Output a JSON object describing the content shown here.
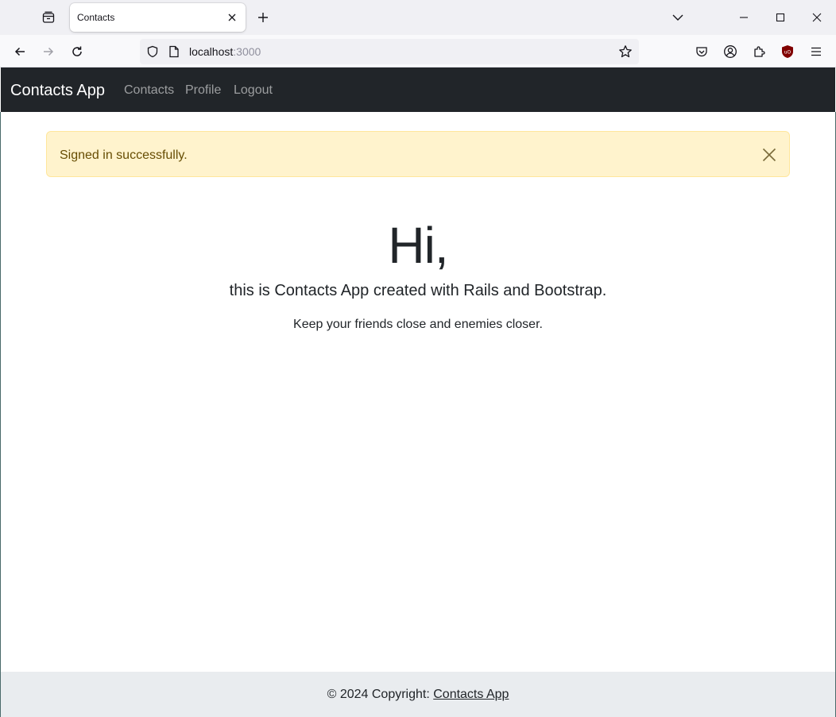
{
  "browser": {
    "tab_title": "Contacts",
    "url_host": "localhost",
    "url_port": ":3000",
    "icons": [
      "tab-list-icon",
      "close-icon",
      "plus-icon",
      "chevron-down-icon",
      "minimize-icon",
      "maximize-icon",
      "close-window-icon",
      "back-icon",
      "forward-icon",
      "reload-icon",
      "shield-icon",
      "page-icon",
      "star-icon",
      "pocket-icon",
      "account-icon",
      "extensions-icon",
      "ublock-icon",
      "menu-icon"
    ]
  },
  "navbar": {
    "brand": "Contacts App",
    "links": [
      "Contacts",
      "Profile",
      "Logout"
    ]
  },
  "alert": {
    "message": "Signed in successfully."
  },
  "hero": {
    "title": "Hi,",
    "lead": "this is Contacts App created with Rails and Bootstrap.",
    "subtitle": "Keep your friends close and enemies closer."
  },
  "footer": {
    "prefix": "© 2024 Copyright: ",
    "link": "Contacts App"
  },
  "colors": {
    "navbar_bg": "#212529",
    "alert_bg": "#fff3cd",
    "alert_text": "#664d03",
    "footer_bg": "#e9ecef"
  }
}
